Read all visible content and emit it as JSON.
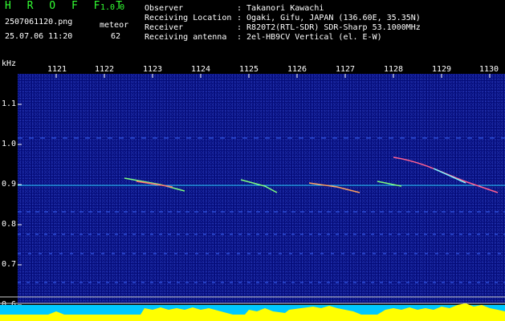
{
  "app": {
    "name": "H R O F F T",
    "version": "1.0.0"
  },
  "capture": {
    "filename": "2507061120.png",
    "datetime": "25.07.06 11:20",
    "type": "meteor",
    "count": "62"
  },
  "info": {
    "labels": [
      "Observer",
      "Receiving Location",
      "Receiver",
      "Receiving antenna"
    ],
    "values": [
      ": Takanori Kawachi",
      ": Ogaki, Gifu, JAPAN (136.60E, 35.35N)",
      ": R820T2(RTL-SDR) SDR-Sharp 53.1000MHz",
      ": 2el-HB9CV Vertical (el. E-W)"
    ]
  },
  "axis": {
    "unit": "kHz",
    "x_ticks": [
      "1121",
      "1122",
      "1123",
      "1124",
      "1125",
      "1126",
      "1127",
      "1128",
      "1129",
      "1130"
    ],
    "y_ticks": [
      "1.1",
      "1.0",
      "0.9",
      "0.8",
      "0.7",
      "0.6"
    ]
  },
  "colors": {
    "background": "#000000",
    "waterfall": "#050d7a",
    "text": "#ffffff",
    "title": "#33ff33",
    "signal": "#ffff00",
    "baseline": "#00ccff"
  }
}
